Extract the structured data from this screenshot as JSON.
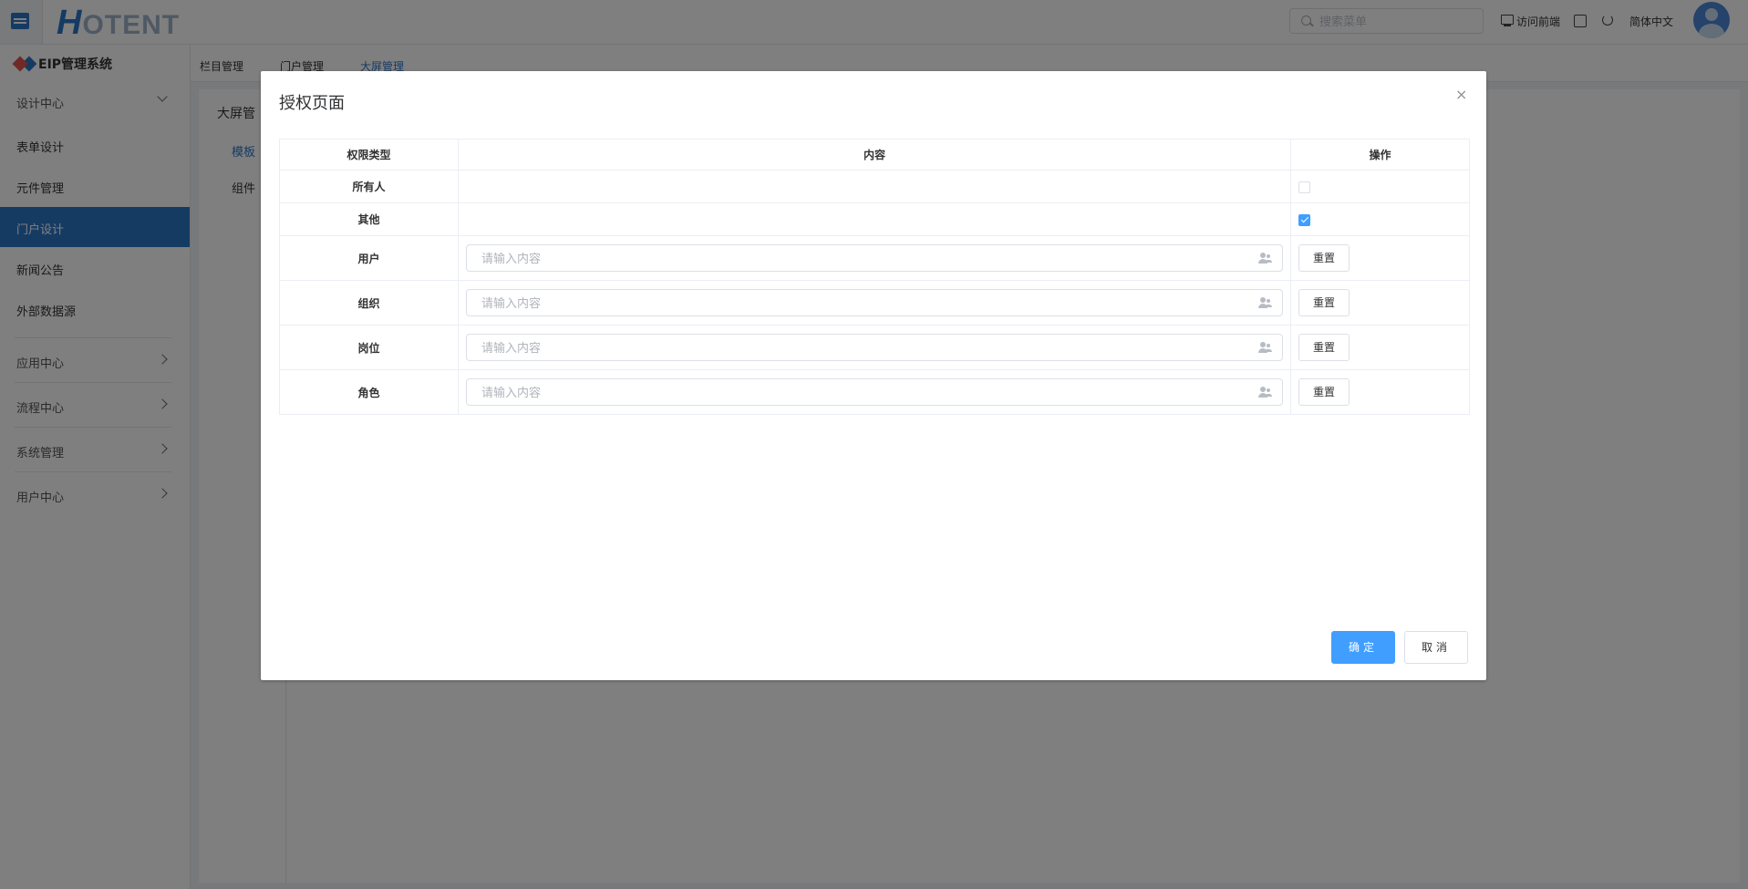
{
  "header": {
    "logo_mark": "H",
    "logo_text": "OTENT",
    "search_placeholder": "搜索菜单",
    "visit_frontend": "访问前端",
    "language": "简体中文",
    "icons": [
      "menu-toggle-icon",
      "search-icon",
      "monitor-icon",
      "fullscreen-icon",
      "refresh-icon",
      "avatar"
    ]
  },
  "sidebar": {
    "system_title": "EIP管理系统",
    "groups": [
      {
        "label": "设计中心",
        "expanded": true
      },
      {
        "label": "应用中心"
      },
      {
        "label": "流程中心"
      },
      {
        "label": "系统管理"
      },
      {
        "label": "用户中心"
      }
    ],
    "items": [
      {
        "label": "表单设计"
      },
      {
        "label": "元件管理"
      },
      {
        "label": "门户设计",
        "active": true
      },
      {
        "label": "新闻公告"
      },
      {
        "label": "外部数据源"
      }
    ]
  },
  "tabs": [
    {
      "label": "栏目管理"
    },
    {
      "label": "门户管理"
    },
    {
      "label": "大屏管理",
      "active": true
    }
  ],
  "content": {
    "tree_title": "大屏管",
    "tree_items": [
      "模板",
      "组件"
    ]
  },
  "dialog": {
    "title": "授权页面",
    "close": "×",
    "columns": [
      "权限类型",
      "内容",
      "操作"
    ],
    "rows": [
      {
        "type": "所有人",
        "checkbox": true,
        "checked": false
      },
      {
        "type": "其他",
        "checkbox": true,
        "checked": true
      },
      {
        "type": "用户",
        "placeholder": "请输入内容",
        "action": "重置"
      },
      {
        "type": "组织",
        "placeholder": "请输入内容",
        "action": "重置"
      },
      {
        "type": "岗位",
        "placeholder": "请输入内容",
        "action": "重置"
      },
      {
        "type": "角色",
        "placeholder": "请输入内容",
        "action": "重置"
      }
    ],
    "confirm": "确定",
    "cancel": "取消"
  },
  "colors": {
    "primary": "#2d76c7",
    "confirm": "#409eff",
    "overlay": "rgba(0,0,0,0.5)"
  }
}
